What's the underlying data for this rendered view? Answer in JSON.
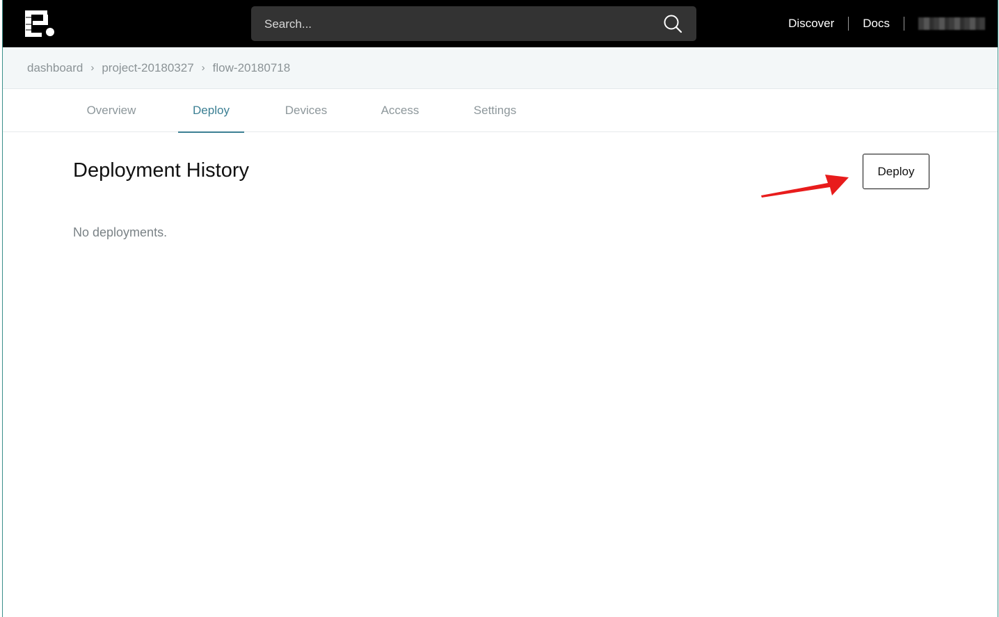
{
  "header": {
    "search_placeholder": "Search...",
    "links": [
      "Discover",
      "Docs"
    ]
  },
  "breadcrumb": [
    "dashboard",
    "project-20180327",
    "flow-20180718"
  ],
  "breadcrumb_separator": "›",
  "tabs": [
    "Overview",
    "Deploy",
    "Devices",
    "Access",
    "Settings"
  ],
  "active_tab": "Deploy",
  "main": {
    "title": "Deployment History",
    "deploy_label": "Deploy",
    "empty_message": "No deployments."
  },
  "colors": {
    "topbar": "#000000",
    "accent": "#3b7f93",
    "annotation_arrow": "#e81c1c"
  },
  "icons": [
    "app-logo-icon",
    "search-icon",
    "annotation-arrow-icon"
  ]
}
